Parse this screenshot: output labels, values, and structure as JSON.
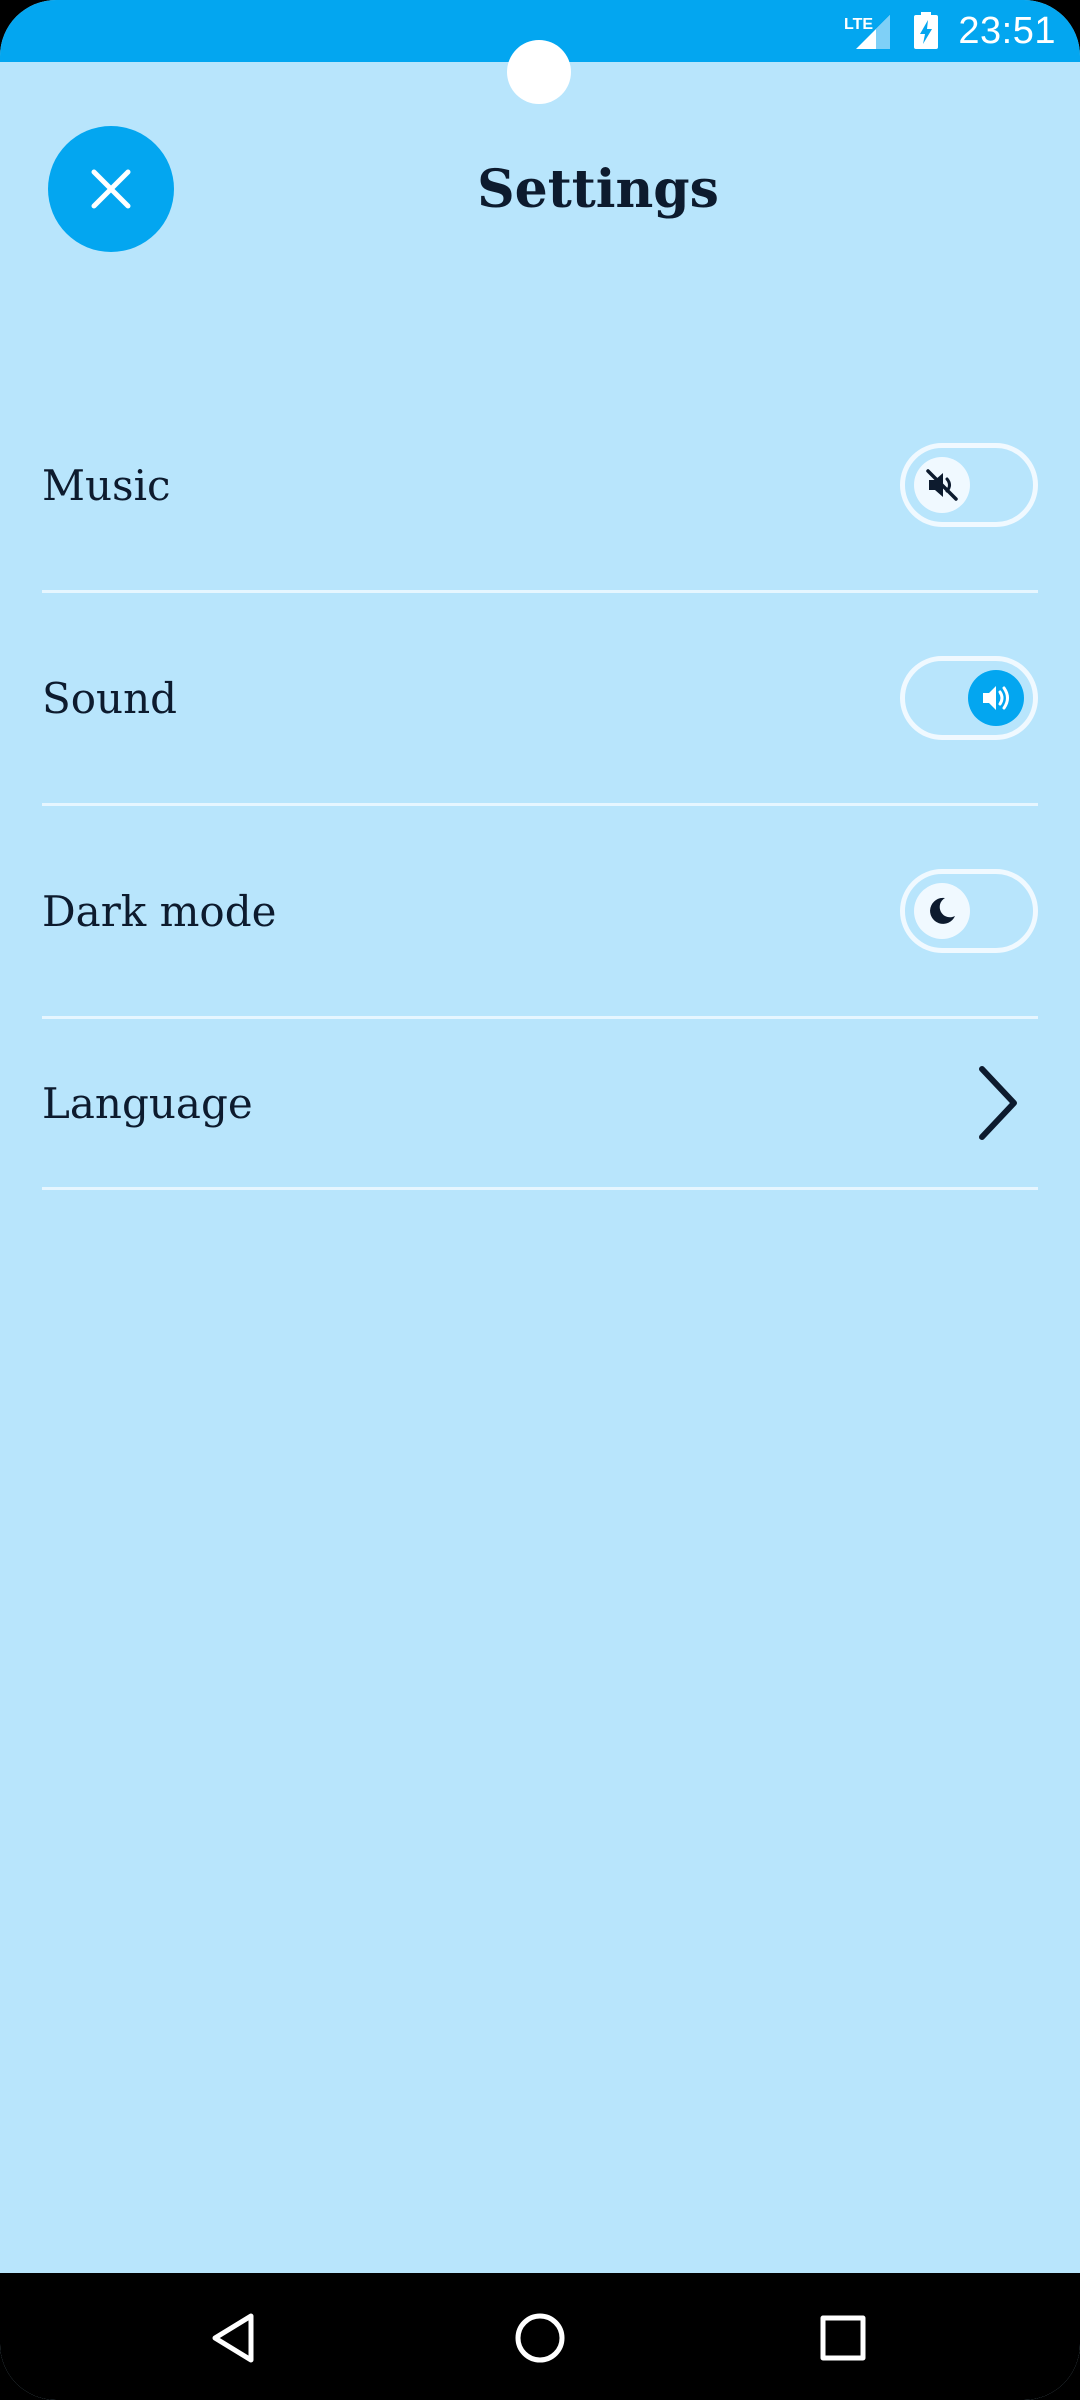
{
  "status_bar": {
    "time": "23:51",
    "network_label": "LTE",
    "icons": [
      "lte-signal-icon",
      "battery-charging-icon"
    ],
    "background_color": "#03a6f0"
  },
  "header": {
    "title": "Settings",
    "close_icon": "close-icon",
    "accent_color": "#03a6f0"
  },
  "settings": [
    {
      "label": "Music",
      "type": "toggle",
      "enabled": false,
      "icon": "volume-muted-icon"
    },
    {
      "label": "Sound",
      "type": "toggle",
      "enabled": true,
      "icon": "volume-on-icon"
    },
    {
      "label": "Dark mode",
      "type": "toggle",
      "enabled": false,
      "icon": "moon-icon"
    },
    {
      "label": "Language",
      "type": "link",
      "icon": "chevron-right-icon"
    }
  ],
  "nav_bar": {
    "icons": [
      "back-icon",
      "home-icon",
      "recents-icon"
    ]
  },
  "colors": {
    "background": "#b8e5fc",
    "text": "#0d1b2e",
    "divider": "#e6f6ff"
  }
}
